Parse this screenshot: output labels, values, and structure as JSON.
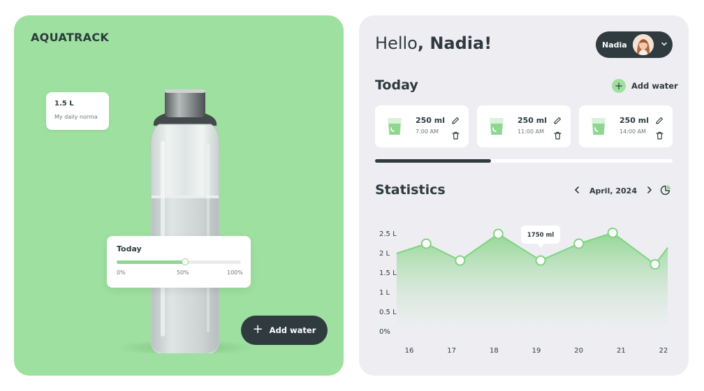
{
  "brand": "AQUATRACK",
  "daily_norm": {
    "value": "1.5 L",
    "label": "My daily norma"
  },
  "today_card": {
    "title": "Today",
    "progress_fraction": 0.55,
    "ticks": [
      "0%",
      "50%",
      "100%"
    ]
  },
  "add_water_big": {
    "label": "Add water"
  },
  "greeting": {
    "prefix": "Hello",
    "name": ", Nadia!"
  },
  "user": {
    "name": "Nadia"
  },
  "today_section": {
    "title": "Today",
    "add_label": "Add water",
    "entries": [
      {
        "amount": "250 ml",
        "time": "7:00 AM"
      },
      {
        "amount": "250 ml",
        "time": "11:00 AM"
      },
      {
        "amount": "250 ml",
        "time": "14:00 AM"
      }
    ],
    "day_progress_fraction": 0.39
  },
  "statistics": {
    "title": "Statistics",
    "month": "April, 2024"
  },
  "colors": {
    "accent": "#9ee09f",
    "dark": "#2f3b3f",
    "panel": "#eeeef2",
    "line": "#7fd480"
  },
  "chart_data": {
    "type": "area",
    "x": [
      "16",
      "17",
      "18",
      "19",
      "20",
      "21",
      "22"
    ],
    "ytick_labels": [
      "0%",
      "0.5 L",
      "1 L",
      "1.5 L",
      "2 L",
      "2.5 L"
    ],
    "ylim": [
      0,
      2.5
    ],
    "series": [
      {
        "points": [
          {
            "x": 15.7,
            "y": 2.0,
            "marker": false
          },
          {
            "x": 16.4,
            "y": 2.25,
            "marker": true
          },
          {
            "x": 17.2,
            "y": 1.82,
            "marker": true
          },
          {
            "x": 18.1,
            "y": 2.5,
            "marker": true
          },
          {
            "x": 19.1,
            "y": 1.82,
            "marker": true
          },
          {
            "x": 20.0,
            "y": 2.25,
            "marker": true
          },
          {
            "x": 20.8,
            "y": 2.53,
            "marker": true
          },
          {
            "x": 21.8,
            "y": 1.72,
            "marker": true
          },
          {
            "x": 22.1,
            "y": 2.15,
            "marker": false
          }
        ]
      }
    ],
    "annotation": {
      "x": 19.1,
      "y": 1.75,
      "label": "1750 ml"
    }
  }
}
